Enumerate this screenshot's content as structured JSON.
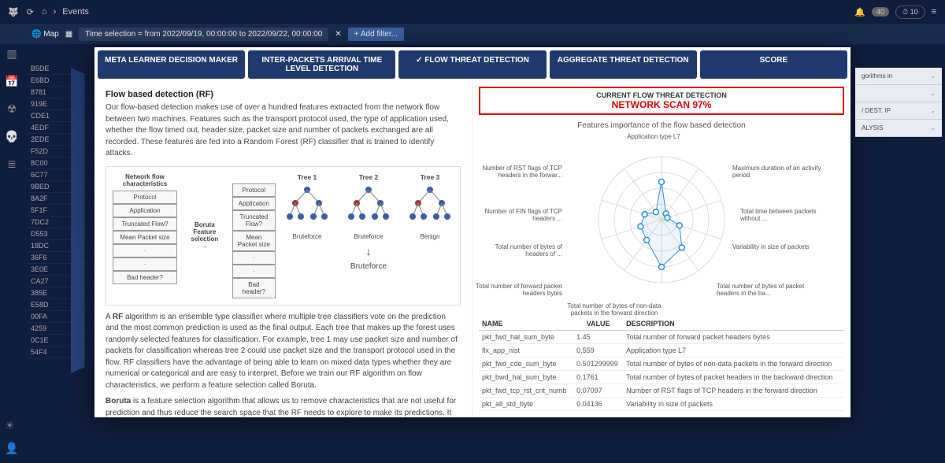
{
  "header": {
    "breadcrumb_sep": "›",
    "breadcrumb_page": "Events",
    "notif_count": "40",
    "clock": "10"
  },
  "filterbar": {
    "map_label": "Map",
    "time_chip": "Time selection = from 2022/09/19, 00:00:00 to 2022/09/22, 00:00:00",
    "add_filter": "+  Add filter..."
  },
  "bg_rows": [
    "B5DE",
    "E6BD",
    "8781",
    "919E",
    "CDE1",
    "4EDF",
    "2EDE",
    "F52D",
    "8C00",
    "6C77",
    "9BED",
    "8A2F",
    "5F1F",
    "7DC2",
    "D553",
    "18DC",
    "36F6",
    "3E0E",
    "CA27",
    "385E",
    "E58D",
    "00FA",
    "4259",
    "0C1E",
    "54F4"
  ],
  "tabs": {
    "t1": "META LEARNER DECISION MAKER",
    "t2": "INTER-PACKETS ARRIVAL TIME LEVEL DETECTION",
    "t3": "FLOW THREAT DETECTION",
    "t4": "AGGREGATE THREAT DETECTION",
    "t5": "SCORE"
  },
  "left": {
    "title": "Flow based detection (RF)",
    "p1": "Our flow-based detection makes use of over a hundred features extracted from the network flow between two machines. Features such as the transport protocol used, the type of application used, whether the flow timed out, header size, packet size and number of packets exchanged are all recorded. These features are fed into a Random Forest (RF) classifier that is trained to identify attacks.",
    "diag_hdr1": "Network flow\ncharacteristics",
    "feats": [
      "Protocol",
      "Application",
      "Truncated Flow?",
      "Mean Packet size",
      "·",
      "·",
      "Bad header?"
    ],
    "boruta1": "Boruta",
    "boruta2": "Feature selection",
    "trees": [
      {
        "name": "Tree 1",
        "leaf": "Bruteforce"
      },
      {
        "name": "Tree 2",
        "leaf": "Bruteforce"
      },
      {
        "name": "Tree 3",
        "leaf": "Benign"
      }
    ],
    "final_leaf": "Bruteforce",
    "p2_1": "A ",
    "p2_rf": "RF",
    "p2_2": " algorithm is an ensemble type classifier where multiple tree classifiers vote on the prediction and the most common prediction is used as the final output. Each tree that makes up the forest uses randomly selected features for classification. For example, tree 1 may use packet size and number of packets for classification whereas tree 2 could use packet size and the transport protocol used in the flow. RF classifiers have the advantage of being able to learn on mixed data types whether they are numerical or categorical and are easy to interpret. Before we train our RF algorithm on flow characteristics, we perform a feature selection called Boruta.",
    "p3_b": "Boruta",
    "p3": " is a feature selection algorithm that allows us to remove characteristics that are not useful for prediction and thus reduce the search space that the RF needs to explore to make its predictions. It makes the training faster and reduces the complexity of the model. Boruta works by comparing each feature used by the RF to a shuffled version of the RF where all features are randomly mixed. If the selected feature classifies better than the shuffled version then it is considered useful for classification and will be kept in the final RF model."
  },
  "right": {
    "alert_t": "CURRENT FLOW THREAT DETECTION",
    "alert_v": "NETWORK SCAN 97%",
    "chart_title": "Features importance of the flow based detection",
    "axes": [
      "Application type L7",
      "Maximum duration of an activity period",
      "Total time between packets without ...",
      "Variability in size of packets",
      "Total number of bytes of packet headers in the ba...",
      "Total number of bytes of non-data packets in the forward direction",
      "Total number of forward packet headers bytes",
      "Total number of bytes of headers of ...",
      "Number of FIN flags of TCP headers ...",
      "Number of RST flags of TCP headers in the forwar..."
    ],
    "tbl_hdr": {
      "name": "NAME",
      "value": "VALUE",
      "desc": "DESCRIPTION"
    },
    "rows": [
      {
        "name": "pkt_fwd_hal_sum_byte",
        "value": "1.45",
        "desc": "Total number of forward packet headers bytes"
      },
      {
        "name": "flx_app_nist",
        "value": "0.559",
        "desc": "Application type L7"
      },
      {
        "name": "pkt_fwd_cde_sum_byte",
        "value": "0.501299999",
        "desc": "Total number of bytes of non-data packets in the forward direction"
      },
      {
        "name": "pkt_bwd_hal_sum_byte",
        "value": "0.1761",
        "desc": "Total number of bytes of packet headers in the backward direction"
      },
      {
        "name": "pkt_fwd_tcp_rst_cnt_numb",
        "value": "0.07097",
        "desc": "Number of RST flags of TCP headers in the forward direction"
      },
      {
        "name": "pkt_all_std_byte",
        "value": "0.04136",
        "desc": "Variability in size of packets"
      }
    ]
  },
  "side": {
    "items": [
      "gorithms in",
      "",
      "/ DEST. IP",
      "ALYSIS"
    ]
  },
  "chart_data": {
    "type": "radar",
    "title": "Features importance of the flow based detection",
    "axes": [
      "Application type L7",
      "Maximum duration of an activity period",
      "Total time between packets without ...",
      "Variability in size of packets",
      "Total number of bytes of packet headers in the backward direction",
      "Total number of bytes of non-data packets in the forward direction",
      "Total number of forward packet headers bytes",
      "Total number of bytes of headers of ...",
      "Number of FIN flags of TCP headers ...",
      "Number of RST flags of TCP headers in the forward direction"
    ],
    "values": [
      0.6,
      0.12,
      0.1,
      0.3,
      0.55,
      0.75,
      0.4,
      0.35,
      0.28,
      0.15
    ],
    "range": [
      0,
      1
    ]
  }
}
